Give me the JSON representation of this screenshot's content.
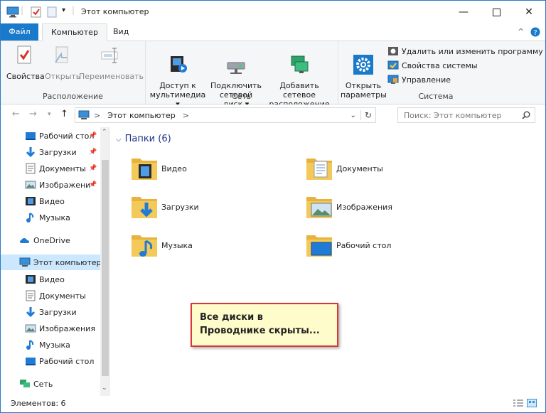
{
  "window": {
    "title": "Этот компьютер",
    "minimize_icon": "minimize-icon",
    "maximize_icon": "maximize-icon",
    "close_icon": "close-icon"
  },
  "ribbon_tabs": [
    {
      "label": "Файл"
    },
    {
      "label": "Компьютер"
    },
    {
      "label": "Вид"
    }
  ],
  "ribbon": {
    "groups": [
      {
        "title": "Расположение",
        "buttons": [
          {
            "label": "Свойства",
            "icon": "properties-icon",
            "enabled": true
          },
          {
            "label": "Открыть",
            "icon": "open-icon",
            "enabled": false
          },
          {
            "label": "Переименовать",
            "icon": "rename-icon",
            "enabled": false
          }
        ]
      },
      {
        "title": "Сеть",
        "buttons": [
          {
            "label": "Доступ к\nмультимедиа ▾",
            "icon": "media-access-icon",
            "enabled": true
          },
          {
            "label": "Подключить\nсетевой диск ▾",
            "icon": "map-network-drive-icon",
            "enabled": true
          },
          {
            "label": "Добавить сетевое\nрасположение",
            "icon": "add-network-location-icon",
            "enabled": true
          }
        ]
      },
      {
        "title": "Система",
        "buttons": [
          {
            "label": "Открыть\nпараметры",
            "icon": "settings-gear-icon",
            "enabled": true
          }
        ],
        "small_buttons": [
          {
            "label": "Удалить или изменить программу",
            "icon": "uninstall-icon"
          },
          {
            "label": "Свойства системы",
            "icon": "system-properties-icon"
          },
          {
            "label": "Управление",
            "icon": "management-icon"
          }
        ]
      }
    ]
  },
  "address": {
    "path": "Этот компьютер",
    "separator": ">",
    "search_placeholder": "Поиск: Этот компьютер"
  },
  "nav_pane": {
    "quick_access": [
      {
        "label": "Рабочий стол",
        "icon": "desktop-icon",
        "pinned": true
      },
      {
        "label": "Загрузки",
        "icon": "downloads-icon",
        "pinned": true
      },
      {
        "label": "Документы",
        "icon": "documents-icon",
        "pinned": true
      },
      {
        "label": "Изображени",
        "icon": "pictures-icon",
        "pinned": true
      },
      {
        "label": "Видео",
        "icon": "video-icon",
        "pinned": false
      },
      {
        "label": "Музыка",
        "icon": "music-icon",
        "pinned": false
      }
    ],
    "onedrive": {
      "label": "OneDrive",
      "icon": "onedrive-icon"
    },
    "this_pc": {
      "label": "Этот компьютер",
      "icon": "computer-icon"
    },
    "this_pc_items": [
      {
        "label": "Видео",
        "icon": "video-icon"
      },
      {
        "label": "Документы",
        "icon": "documents-icon"
      },
      {
        "label": "Загрузки",
        "icon": "downloads-icon"
      },
      {
        "label": "Изображения",
        "icon": "pictures-icon"
      },
      {
        "label": "Музыка",
        "icon": "music-icon"
      },
      {
        "label": "Рабочий стол",
        "icon": "desktop-icon"
      }
    ],
    "network": {
      "label": "Сеть",
      "icon": "network-icon"
    }
  },
  "content": {
    "group_header": "Папки (6)",
    "folders": [
      {
        "label": "Видео",
        "icon": "video-folder-icon"
      },
      {
        "label": "Документы",
        "icon": "documents-folder-icon"
      },
      {
        "label": "Загрузки",
        "icon": "downloads-folder-icon"
      },
      {
        "label": "Изображения",
        "icon": "pictures-folder-icon"
      },
      {
        "label": "Музыка",
        "icon": "music-folder-icon"
      },
      {
        "label": "Рабочий стол",
        "icon": "desktop-folder-icon"
      }
    ]
  },
  "callout": {
    "text": "Все диски в\nПроводнике скрыты..."
  },
  "status": {
    "items_count": "Элементов: 6"
  },
  "colors": {
    "accent": "#1979ca",
    "selection": "#cce8ff",
    "folder": "#f3c959",
    "callout_border": "#d93636",
    "callout_bg": "#fefccb"
  }
}
